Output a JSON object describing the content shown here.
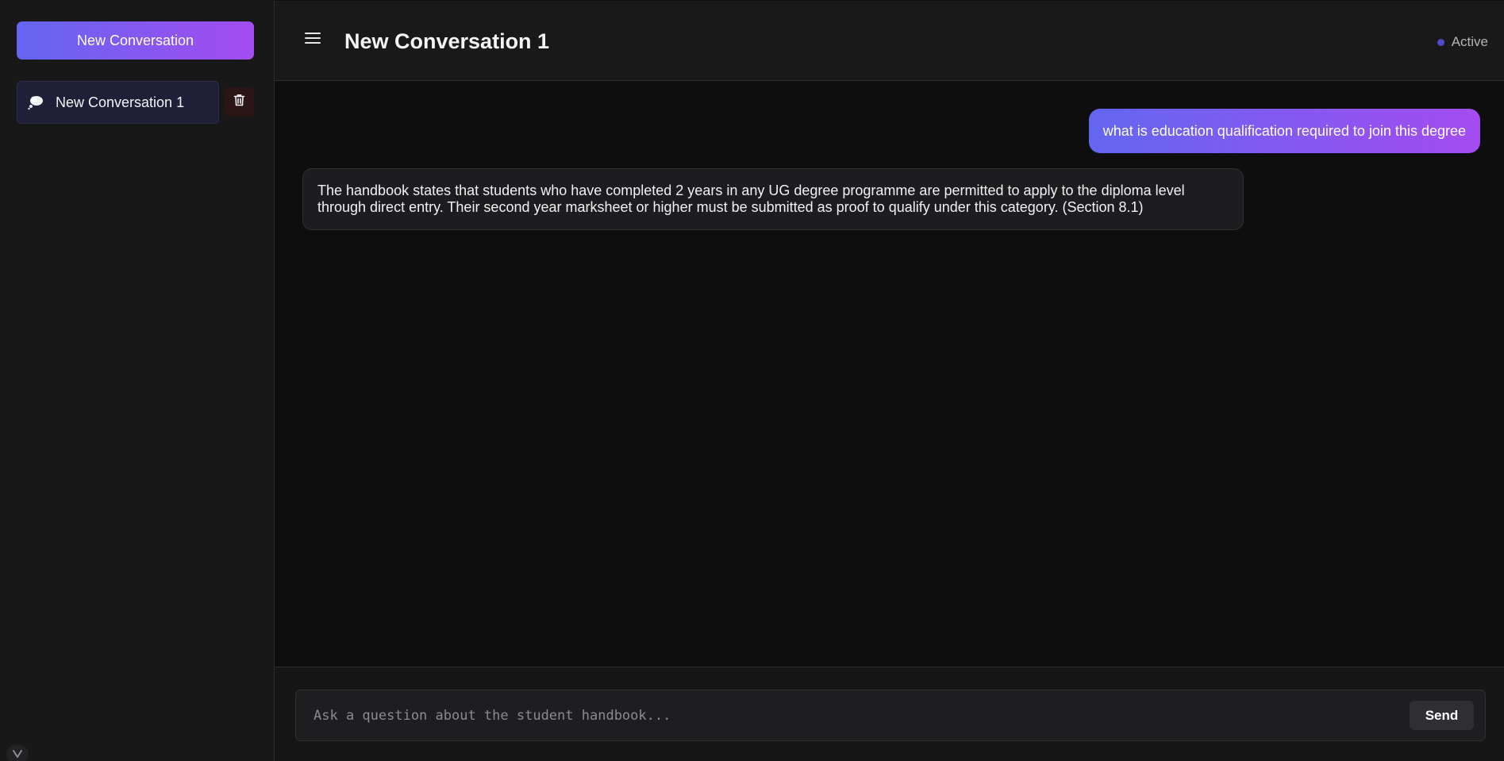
{
  "sidebar": {
    "new_conversation_label": "New Conversation",
    "conversations": [
      {
        "label": "New Conversation 1",
        "icon": "thought-bubble-icon"
      }
    ],
    "delete_icon": "trash-icon"
  },
  "header": {
    "menu_icon": "hamburger-menu-icon",
    "title": "New Conversation 1",
    "status_label": "Active",
    "status_color": "#4b49cc"
  },
  "messages": [
    {
      "role": "user",
      "text": "what is education qualification required to join this degree"
    },
    {
      "role": "assistant",
      "text": "The handbook states that students who have completed 2 years in any UG degree programme are permitted to apply to the diploma level through direct entry. Their second year marksheet or higher must be submitted as proof to qualify under this category. (Section 8.1)"
    }
  ],
  "composer": {
    "placeholder": "Ask a question about the student handbook...",
    "value": "",
    "send_label": "Send"
  },
  "colors": {
    "accent_start": "#6366f1",
    "accent_end": "#a44cf1",
    "background": "#0e0e0f",
    "sidebar_bg": "#181819",
    "active_item_bg": "#1f2038",
    "delete_bg": "#2b1517"
  }
}
